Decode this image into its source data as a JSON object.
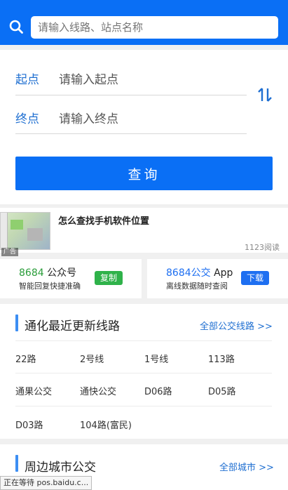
{
  "search": {
    "placeholder": "请输入线路、站点名称"
  },
  "route_form": {
    "from_label": "起点",
    "from_placeholder": "请输入起点",
    "to_label": "终点",
    "to_placeholder": "请输入终点",
    "query_label": "查询"
  },
  "ad": {
    "badge": "广告",
    "title": "怎么查找手机软件位置",
    "reads": "1123阅读"
  },
  "promo": {
    "wechat": {
      "brand": "8684",
      "name": "公众号",
      "sub": "智能回复快捷准确",
      "button": "复制"
    },
    "app": {
      "brand": "8684公交",
      "name": "App",
      "sub": "离线数据随时查阅",
      "button": "下载"
    }
  },
  "recent_lines": {
    "title": "通化最近更新线路",
    "link": "全部公交线路 >>",
    "routes": [
      "22路",
      "2号线",
      "1号线",
      "113路",
      "通果公交",
      "通快公交",
      "D06路",
      "D05路",
      "D03路",
      "104路(富民)"
    ]
  },
  "nearby": {
    "title": "周边城市公交",
    "link": "全部城市 >>"
  },
  "status_bar": {
    "text": "正在等待 pos.baidu.c..."
  },
  "colors": {
    "accent": "#0a6ff5",
    "label_blue": "#1f6fd1",
    "copy_green": "#2fb24a",
    "download_blue": "#1e6ff1",
    "brand_green": "#2a9d3a"
  }
}
